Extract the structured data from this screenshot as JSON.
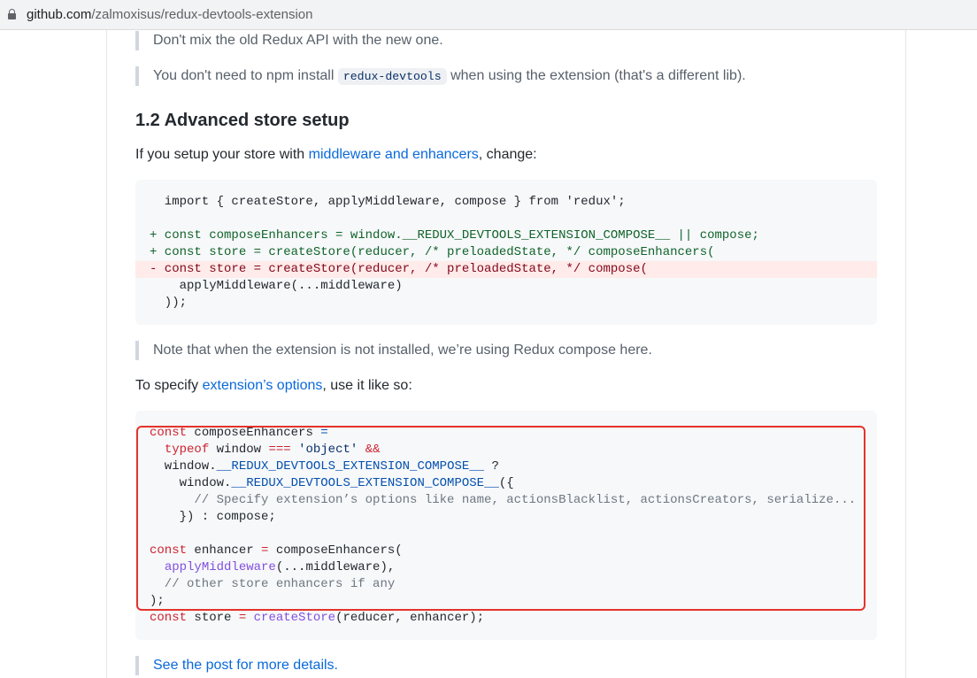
{
  "browser": {
    "url_host": "github.com",
    "url_path": "/zalmoxisus/redux-devtools-extension"
  },
  "content": {
    "quote1": "Don't mix the old Redux API with the new one.",
    "quote2_before": "You don't need to npm install ",
    "quote2_code": "redux-devtools",
    "quote2_after": " when using the extension (that's a different lib).",
    "heading": "1.2 Advanced store setup",
    "para1_before": "If you setup your store with ",
    "para1_link": "middleware and enhancers",
    "para1_after": ", change:",
    "code1": {
      "line1": "  import { createStore, applyMiddleware, compose } from 'redux';",
      "line3": "+ const composeEnhancers = window.__REDUX_DEVTOOLS_EXTENSION_COMPOSE__ || compose;",
      "line4": "+ const store = createStore(reducer, /* preloadedState, */ composeEnhancers(",
      "line5": "- const store = createStore(reducer, /* preloadedState, */ compose(",
      "line6": "    applyMiddleware(...middleware)",
      "line7": "  ));"
    },
    "quote3": "Note that when the extension is not installed, we’re using Redux compose here.",
    "para2_before": "To specify ",
    "para2_link": "extension’s options",
    "para2_after": ", use it like so:",
    "code2": {
      "kw_const": "const",
      "kw_typeof": "typeof",
      "l1_name": " composeEnhancers ",
      "op_eq": "=",
      "l2_mid": " window ",
      "op_strict": "===",
      "str_object": "'object'",
      "op_and": "&&",
      "l3_window": "  window.",
      "compose_const": "__REDUX_DEVTOOLS_EXTENSION_COMPOSE__",
      "l3_q": " ?",
      "l4_window": "    window.",
      "l4_open": "({",
      "l5_comment": "      // Specify extension’s options like name, actionsBlacklist, actionsCreators, serialize...",
      "l6": "    }) : compose;",
      "l8_name": " enhancer ",
      "l8_call": " composeEnhancers(",
      "fn_apply": "applyMiddleware",
      "l9_rest": "(...middleware),",
      "l10_comment": "  // other store enhancers if any",
      "l11": ");",
      "l12_name": " store ",
      "fn_create": "createStore",
      "l12_rest": "(reducer, enhancer);"
    },
    "quote4": "See the post for more details."
  },
  "colors": {
    "link": "#0969da",
    "highlight_border": "#e5332a",
    "diff_add": "#116329",
    "diff_del": "#82071e"
  },
  "icons": {
    "url_lock": "lock-icon"
  }
}
